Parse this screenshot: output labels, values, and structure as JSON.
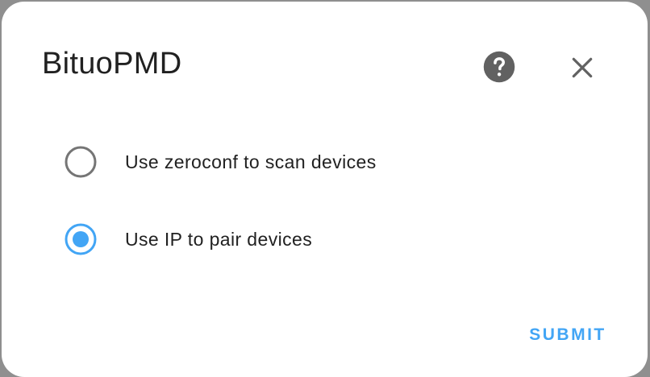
{
  "dialog": {
    "title": "BituoPMD",
    "help_icon": "help-circle-icon",
    "close_icon": "close-icon"
  },
  "options": [
    {
      "label": "Use zeroconf to scan devices",
      "selected": false
    },
    {
      "label": "Use IP to pair devices",
      "selected": true
    }
  ],
  "actions": {
    "submit_label": "SUBMIT"
  },
  "colors": {
    "accent": "#42a5f5",
    "radio_unselected": "#757575",
    "icon": "#616161",
    "text": "#212121"
  }
}
